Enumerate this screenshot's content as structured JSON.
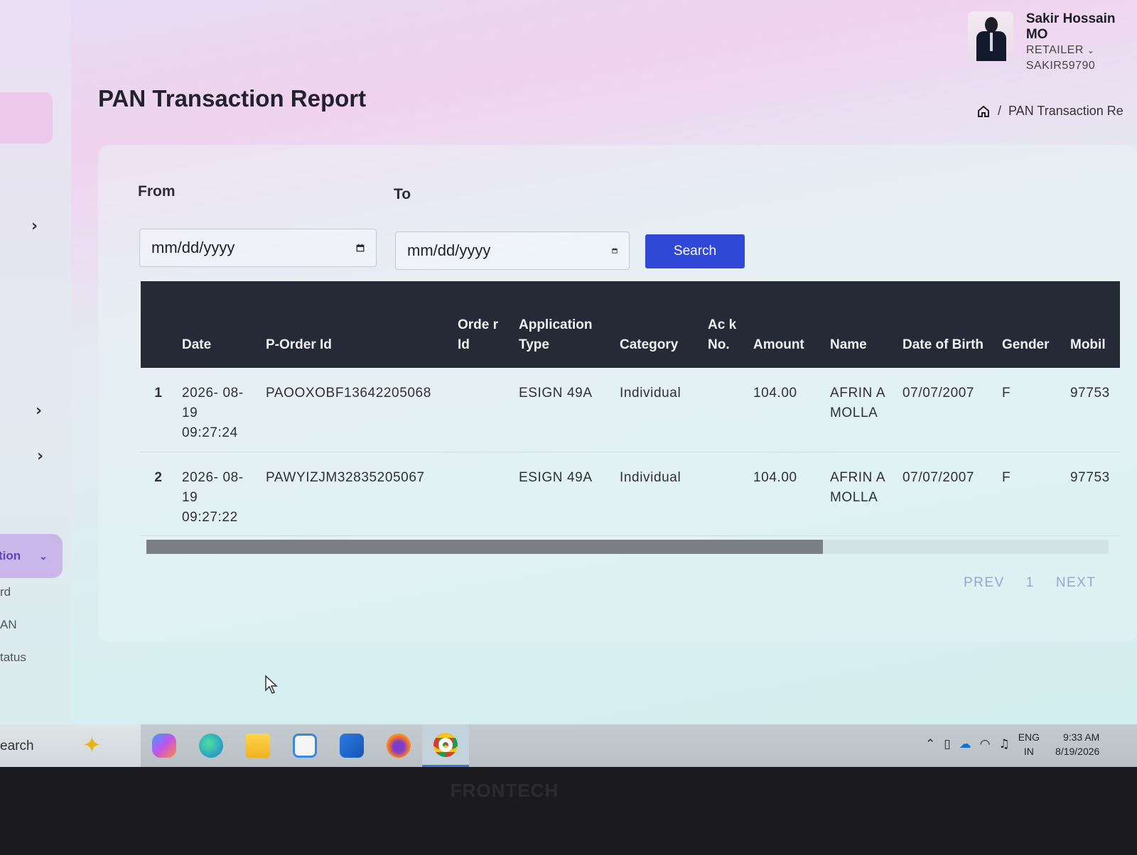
{
  "user": {
    "name": "Sakir Hossain MO",
    "role": "RETAILER",
    "user_id": "SAKIR59790"
  },
  "page": {
    "title": "PAN Transaction Report"
  },
  "breadcrumb": {
    "current": "PAN Transaction Re"
  },
  "filters": {
    "from_label": "From",
    "to_label": "To",
    "from_placeholder": "mm/dd/yyyy",
    "to_placeholder": "mm/dd/yyyy",
    "search_label": "Search"
  },
  "table": {
    "headers": [
      "",
      "Date",
      "P-Order Id",
      "Orde r Id",
      "Application Type",
      "Category",
      "Ac k No.",
      "Amount",
      "Name",
      "Date of Birth",
      "Gender",
      "Mobil"
    ],
    "rows": [
      {
        "idx": "1",
        "date": "2026- 08-19 09:27:24",
        "p_order_id": "PAOOXOBF13642205068",
        "order_id": "",
        "app_type": "ESIGN 49A",
        "category": "Individual",
        "ack_no": "",
        "amount": "104.00",
        "name": "AFRIN A MOLLA",
        "dob": "07/07/2007",
        "gender": "F",
        "mobile": "97753"
      },
      {
        "idx": "2",
        "date": "2026- 08-19 09:27:22",
        "p_order_id": "PAWYIZJM32835205067",
        "order_id": "",
        "app_type": "ESIGN 49A",
        "category": "Individual",
        "ack_no": "",
        "amount": "104.00",
        "name": "AFRIN A MOLLA",
        "dob": "07/07/2007",
        "gender": "F",
        "mobile": "97753"
      }
    ]
  },
  "pagination": {
    "prev": "PREV",
    "current": "1",
    "next": "NEXT"
  },
  "sidebar": {
    "active_item": "tion",
    "items": [
      "rd",
      "AN",
      "tatus"
    ]
  },
  "taskbar": {
    "search": "earch",
    "language": "ENG",
    "region": "IN",
    "time": "9:33 AM",
    "date": "8/19/2026",
    "apps": [
      "copilot-icon",
      "edge-icon",
      "file-explorer-icon",
      "store-icon",
      "outlook-icon",
      "firefox-icon",
      "chrome-icon"
    ]
  },
  "monitor": {
    "brand": "FRONTECH"
  },
  "colors": {
    "accent": "#2f48d8",
    "table_header": "#252a37",
    "pager": "#9aa3d8"
  }
}
